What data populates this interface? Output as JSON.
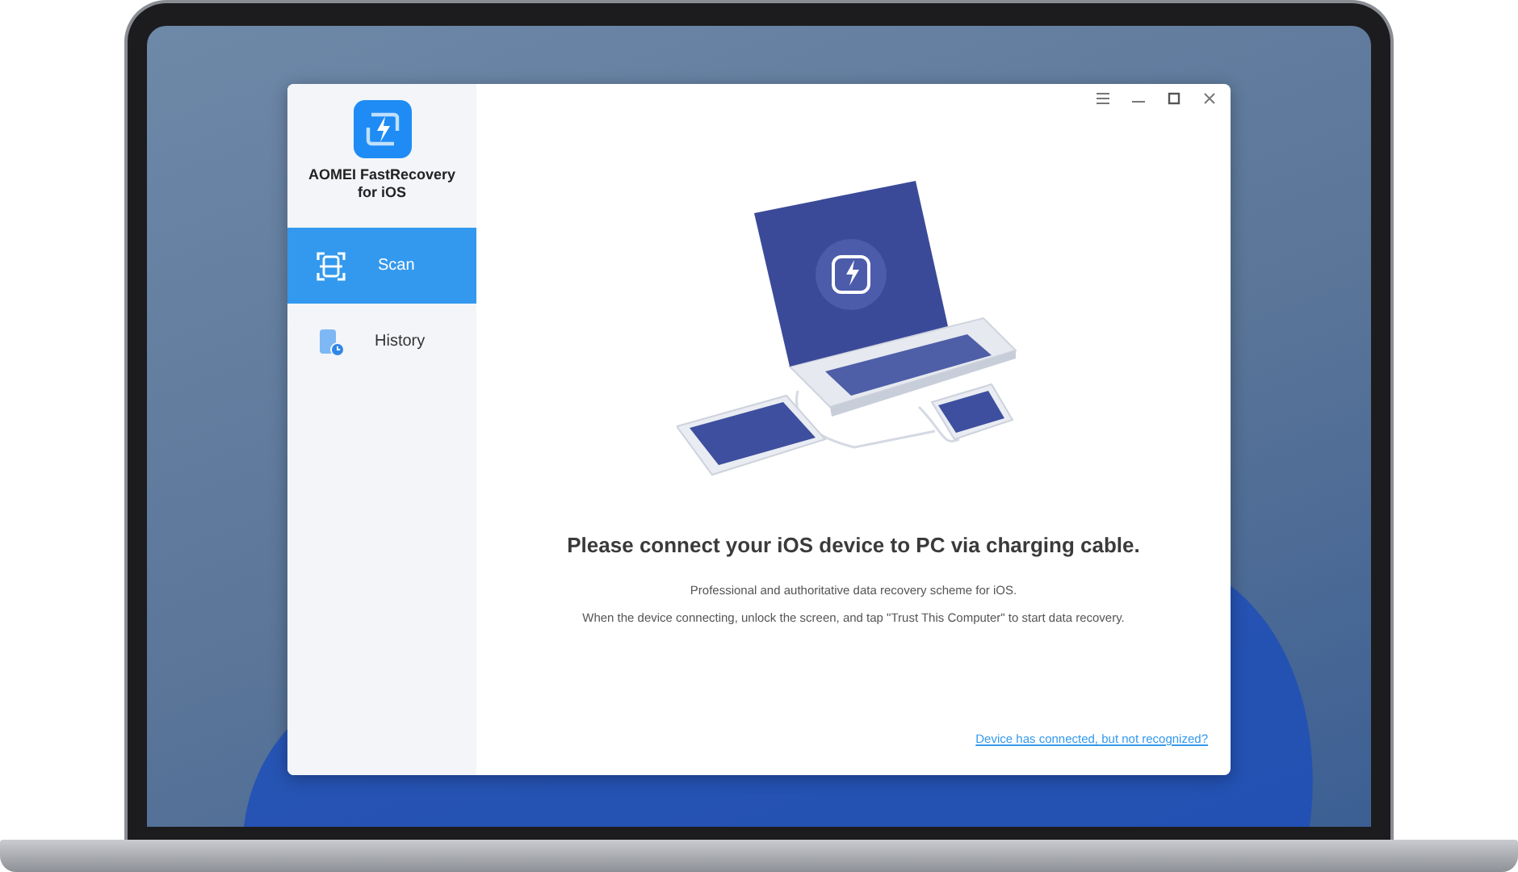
{
  "app": {
    "name": "AOMEI FastRecovery for iOS"
  },
  "window_controls": [
    {
      "kind": "menu"
    },
    {
      "kind": "minimize"
    },
    {
      "kind": "maximize"
    },
    {
      "kind": "close"
    }
  ],
  "sidebar": {
    "items": [
      {
        "label": "Scan",
        "kind": "scan",
        "selected": true
      },
      {
        "label": "History",
        "kind": "history",
        "selected": false
      }
    ]
  },
  "main": {
    "heading": "Please connect your iOS device to PC via charging cable.",
    "paragraphs": [
      "Professional and authoritative data recovery scheme for iOS.",
      "When the device connecting, unlock the screen, and tap \"Trust This Computer\" to start data recovery."
    ],
    "link": "Device has connected, but not recognized?"
  }
}
